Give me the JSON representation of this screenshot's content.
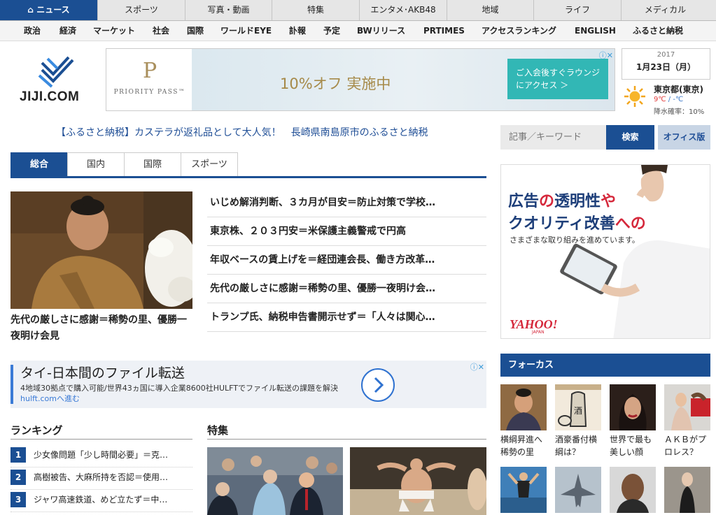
{
  "top_nav": [
    {
      "label": "ニュース",
      "active": true
    },
    {
      "label": "スポーツ"
    },
    {
      "label": "写真・動画"
    },
    {
      "label": "特集"
    },
    {
      "label": "エンタメ･AKB48"
    },
    {
      "label": "地域"
    },
    {
      "label": "ライフ"
    },
    {
      "label": "メディカル"
    }
  ],
  "sub_nav": [
    "政治",
    "経済",
    "マーケット",
    "社会",
    "国際",
    "ワールドEYE",
    "訃報",
    "予定",
    "BWリリース",
    "PRTIMES",
    "アクセスランキング",
    "ENGLISH",
    "ふるさと納税"
  ],
  "logo": {
    "text": "JIJI.COM"
  },
  "ad_banner": {
    "brand_letter": "P",
    "brand": "PRIORITY PASS™",
    "offer": "10%オフ 実施中",
    "cta": "ご入会後すぐラウンジにアクセス ＞"
  },
  "date": {
    "year": "2017",
    "day": "1月23日（月）"
  },
  "weather": {
    "city": "東京都(東京)",
    "high": "9℃",
    "sep": "/",
    "low": "-℃",
    "rain": "降水確率：10%"
  },
  "promo_link": "【ふるさと納税】カステラが返礼品として大人気！　長崎県南島原市のふるさと納税",
  "search": {
    "placeholder": "記事／キーワード",
    "button": "検索",
    "office": "オフィス版"
  },
  "tabs": [
    {
      "label": "総合",
      "active": true
    },
    {
      "label": "国内"
    },
    {
      "label": "国際"
    },
    {
      "label": "スポーツ"
    }
  ],
  "main_story": {
    "caption": "先代の厳しさに感謝＝稀勢の里、優勝一夜明け会見"
  },
  "headlines": [
    "いじめ解消判断、３カ月が目安＝防止対策で学校…",
    "東京株、２０３円安＝米保護主義警戒で円高",
    "年収ベースの賃上げを＝経団連会長、働き方改革…",
    "先代の厳しさに感謝＝稀勢の里、優勝一夜明け会…",
    "トランプ氏、納税申告書開示せず＝「人々は関心…"
  ],
  "ad_wide": {
    "title": "タイ-日本間のファイル転送",
    "body": "4地域30拠点で購入可能/世界43ヵ国に導入企業8600社HULFTでファイル転送の課題を解決",
    "link": "hulft.comへ進む"
  },
  "ranking": {
    "title": "ランキング",
    "items": [
      {
        "num": "1",
        "text": "少女像問題「少し時間必要」＝克…"
      },
      {
        "num": "2",
        "text": "高樹被告、大麻所持を否認＝使用…"
      },
      {
        "num": "3",
        "text": "ジャワ高速鉄道、めど立たず＝中…"
      }
    ]
  },
  "tokushu": {
    "title": "特集"
  },
  "ad_side": {
    "line1_a": "広告",
    "line1_b": "の",
    "line1_c": "透明性",
    "line1_d": "や",
    "line2_a": "クオリティ改善",
    "line2_b": "への",
    "sub": "さまざまな取り組みを進めています。",
    "brand": "YAHOO!",
    "brand_sub": "JAPAN"
  },
  "focus": {
    "title": "フォーカス",
    "items": [
      {
        "caption": "横綱昇進へ稀勢の里"
      },
      {
        "caption": "酒豪番付横綱は？"
      },
      {
        "caption": "世界で最も美しい顔"
      },
      {
        "caption": "ＡＫＢがプロレス？"
      }
    ]
  },
  "colors": {
    "brand_blue": "#1b4f93",
    "link_blue": "#1f4e96",
    "accent_red": "#d5283b"
  }
}
